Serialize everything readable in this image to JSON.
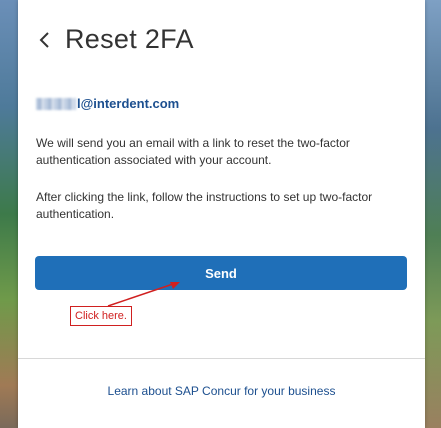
{
  "header": {
    "title": "Reset 2FA",
    "back_icon": "chevron-left-icon"
  },
  "account": {
    "email_visible": "l@interdent.com"
  },
  "body": {
    "paragraph_1": "We will send you an email with a link to reset the two-factor authentication associated with your account.",
    "paragraph_2": "After clicking the link, follow the instructions to set up two-factor authentication."
  },
  "actions": {
    "send_label": "Send"
  },
  "annotation": {
    "label": "Click here."
  },
  "footer": {
    "link_label": "Learn about SAP Concur for your business"
  },
  "colors": {
    "primary_button": "#1f6fb8",
    "link": "#1c4f8f",
    "annotation": "#d02020",
    "text": "#333333"
  }
}
